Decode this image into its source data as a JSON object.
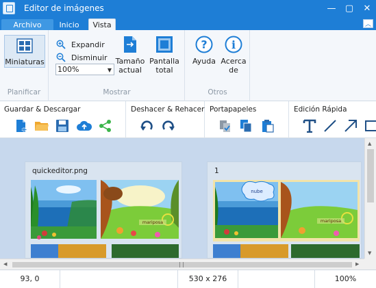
{
  "window": {
    "title": "Editor de imágenes",
    "controls": [
      "—",
      "▢",
      "✕"
    ]
  },
  "tabs": {
    "file": "Archivo",
    "home": "Inicio",
    "view": "Vista",
    "collapse": "︿"
  },
  "ribbon": {
    "thumbnails": "Miniaturas",
    "group_plan": "Planificar",
    "expand": "Expandir",
    "shrink": "Disminuir",
    "zoom_value": "100%",
    "actual_size_1": "Tamaño",
    "actual_size_2": "actual",
    "fullscreen_1": "Pantalla",
    "fullscreen_2": "total",
    "group_show": "Mostrar",
    "help": "Ayuda",
    "about_1": "Acerca",
    "about_2": "de",
    "group_others": "Otros"
  },
  "toolbar": {
    "save_group": "Guardar & Descargar",
    "undo_group": "Deshacer & Rehacer",
    "clipboard_group": "Portapapeles",
    "quick_edit_group": "Edición Rápida"
  },
  "canvas": {
    "page1_label": "quickeditor.png",
    "page2_label": "1",
    "cloud_text": "nube",
    "butterfly_text": "mariposa"
  },
  "status": {
    "coords": "93, 0",
    "size": "530 x 276",
    "zoom": "100%"
  },
  "colors": {
    "accent": "#1e7ed6",
    "canvas": "#c7d8ed"
  }
}
